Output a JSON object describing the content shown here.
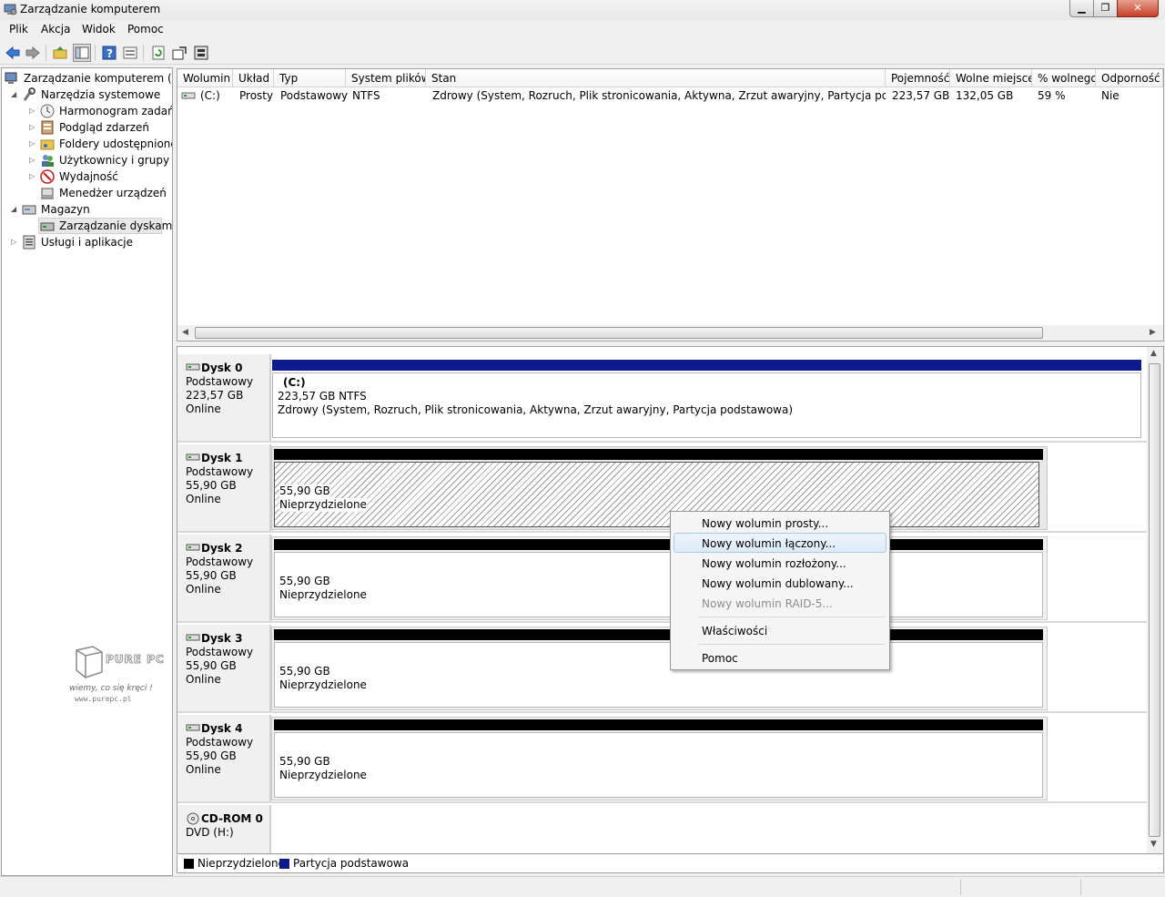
{
  "window": {
    "title": "Zarządzanie komputerem"
  },
  "menubar": {
    "items": [
      "Plik",
      "Akcja",
      "Widok",
      "Pomoc"
    ]
  },
  "toolbar": {
    "icons": [
      "back-icon",
      "forward-icon",
      "up-folder-icon",
      "show-hide-tree-icon",
      "help-icon",
      "properties-icon",
      "refresh-icon",
      "export-icon",
      "settings-icon"
    ]
  },
  "tree": {
    "root": "Zarządzanie komputerem (loka",
    "system_tools": "Narzędzia systemowe",
    "task_scheduler": "Harmonogram zadań",
    "event_viewer": "Podgląd zdarzeń",
    "shared_folders": "Foldery udostępnione",
    "users_groups": "Użytkownicy i grupy lok",
    "performance": "Wydajność",
    "device_manager": "Menedżer urządzeń",
    "storage": "Magazyn",
    "disk_management": "Zarządzanie dyskami",
    "services_apps": "Usługi i aplikacje"
  },
  "volume_list": {
    "columns": [
      "Wolumin",
      "Układ",
      "Typ",
      "System plików",
      "Stan",
      "Pojemność",
      "Wolne miejsce",
      "% wolnego",
      "Odporność n"
    ],
    "rows": [
      {
        "volume": "(C:)",
        "layout": "Prosty",
        "type": "Podstawowy",
        "fs": "NTFS",
        "status": "Zdrowy (System, Rozruch, Plik stronicowania, Aktywna, Zrzut awaryjny, Partycja podstawowa)",
        "capacity": "223,57 GB",
        "free": "132,05 GB",
        "pct_free": "59 %",
        "fault_tolerance": "Nie"
      }
    ]
  },
  "disks": [
    {
      "name": "Dysk 0",
      "type": "Podstawowy",
      "size": "223,57 GB",
      "state": "Online",
      "partition": {
        "label": "(C:)",
        "size_fs": "223,57 GB NTFS",
        "status": "Zdrowy (System, Rozruch, Plik stronicowania, Aktywna, Zrzut awaryjny, Partycja podstawowa)"
      }
    },
    {
      "name": "Dysk 1",
      "type": "Podstawowy",
      "size": "55,90 GB",
      "state": "Online",
      "partition": {
        "size": "55,90 GB",
        "status": "Nieprzydzielone"
      }
    },
    {
      "name": "Dysk 2",
      "type": "Podstawowy",
      "size": "55,90 GB",
      "state": "Online",
      "partition": {
        "size": "55,90 GB",
        "status": "Nieprzydzielone"
      }
    },
    {
      "name": "Dysk 3",
      "type": "Podstawowy",
      "size": "55,90 GB",
      "state": "Online",
      "partition": {
        "size": "55,90 GB",
        "status": "Nieprzydzielone"
      }
    },
    {
      "name": "Dysk 4",
      "type": "Podstawowy",
      "size": "55,90 GB",
      "state": "Online",
      "partition": {
        "size": "55,90 GB",
        "status": "Nieprzydzielone"
      }
    }
  ],
  "cdrom": {
    "name": "CD-ROM 0",
    "drive": "DVD (H:)"
  },
  "legend": {
    "unallocated": "Nieprzydzielone",
    "primary": "Partycja podstawowa"
  },
  "colors": {
    "primary_partition": "#0c1a8c",
    "unallocated": "#000000",
    "selection_bg": "#dceaf9"
  },
  "context_menu": {
    "items": [
      "Nowy wolumin prosty...",
      "Nowy wolumin łączony...",
      "Nowy wolumin rozłożony...",
      "Nowy wolumin dublowany...",
      "Nowy wolumin RAID-5...",
      "Właściwości",
      "Pomoc"
    ]
  },
  "watermark": {
    "logo": "PURE PC",
    "tagline": "wiemy, co się kręci !",
    "url": "www.purepc.pl"
  }
}
